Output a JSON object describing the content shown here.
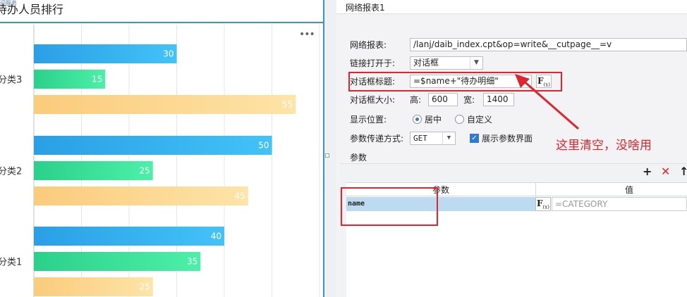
{
  "left": {
    "small_text": "迎服务",
    "title": "待办人员排行",
    "more": "•••"
  },
  "chart_data": {
    "type": "bar",
    "orientation": "horizontal",
    "categories": [
      "分类3",
      "分类2",
      "分类1"
    ],
    "values": [
      [
        30,
        15,
        55
      ],
      [
        50,
        25,
        45
      ],
      [
        40,
        35,
        25
      ]
    ],
    "xlim": [
      0,
      60
    ],
    "grid": true,
    "colors": [
      [
        "#2a9fe6",
        "#42c3f7"
      ],
      [
        "#2bd08a",
        "#4cf0a8"
      ],
      [
        "#fbcb7c",
        "#fde4a8"
      ]
    ]
  },
  "right": {
    "panel_title": "网络报表1",
    "labels": {
      "url": "网络报表:",
      "open_in": "链接打开于:",
      "dialog_title": "对话框标题:",
      "dialog_size": "对话框大小:",
      "height": "高:",
      "width": "宽:",
      "position": "显示位置:",
      "pass_method": "参数传递方式:",
      "params": "参数"
    },
    "values": {
      "url": "/lanj/daib_index.cpt&op=write&__cutpage__=v",
      "open_in": "对话框",
      "dialog_title": "=$name+\"待办明细\"",
      "height": "600",
      "width": "1400",
      "pass_method": "GET"
    },
    "position_options": {
      "center": "居中",
      "custom": "自定义",
      "selected": "center"
    },
    "show_param_ui": {
      "label": "展示参数界面",
      "checked": true
    },
    "fx": "F",
    "fx_sub": "(x)",
    "grid": {
      "col_param": "参数",
      "col_value": "值",
      "rows": [
        {
          "name": "name",
          "value_placeholder": "=CATEGORY"
        }
      ]
    },
    "icons": {
      "add": "+",
      "delete": "✕",
      "up": "↑"
    }
  },
  "annotation": "这里清空，没啥用",
  "colors": {
    "accent_red": "#e0262c",
    "panel_blue": "#3a8fd6"
  }
}
